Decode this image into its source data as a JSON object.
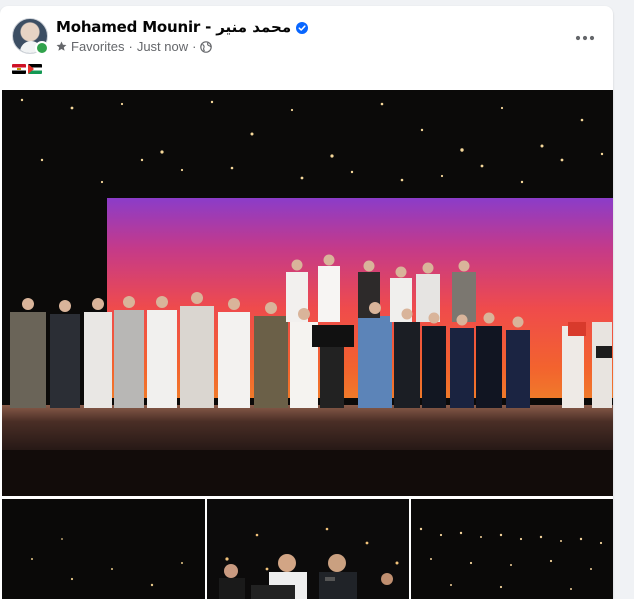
{
  "post": {
    "author": "Mohamed Mounir - محمد منير",
    "audience": "Favorites",
    "separator": "·",
    "timestamp": "Just now",
    "text_flags": [
      "egypt-flag",
      "palestine-flag"
    ]
  },
  "icons": {
    "verified": "verified-badge-icon",
    "favorites": "star-icon",
    "privacy": "globe-icon",
    "more": "more-options-icon"
  },
  "colors": {
    "verified": "#0866ff",
    "online": "#31a24c",
    "meta_text": "#65676b"
  },
  "media": {
    "main_photo": "concert-stage-group-photo",
    "thumbnails": [
      "stage-lights-dark",
      "singer-microphone-closeup",
      "stage-lights-string"
    ]
  }
}
